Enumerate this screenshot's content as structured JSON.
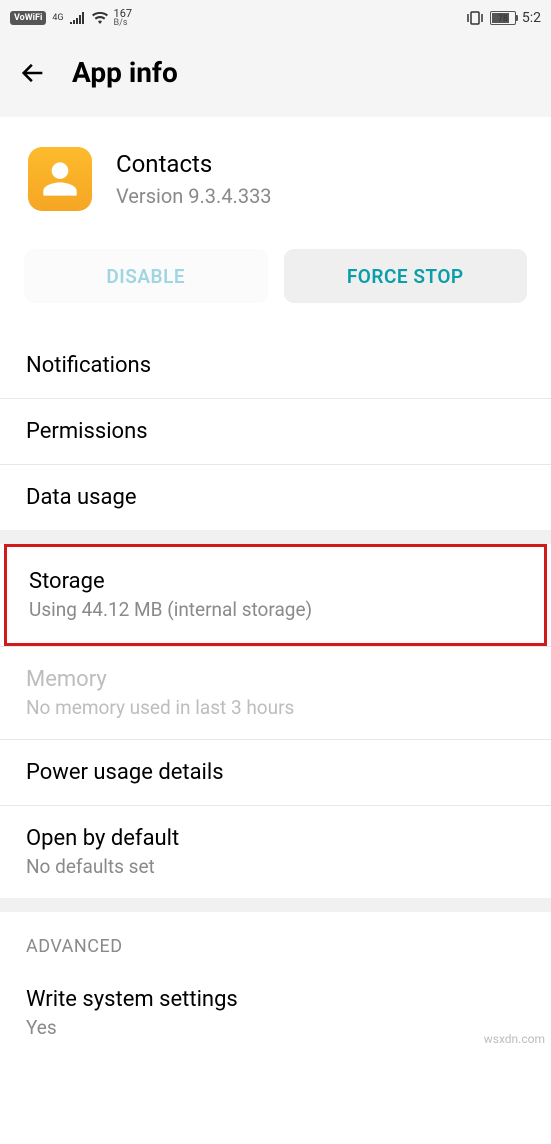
{
  "status": {
    "vowifi": "VoWiFi",
    "signal_gen": "4G",
    "net_speed_value": "167",
    "net_speed_unit": "B/s",
    "battery_pct": "78",
    "time": "5:2"
  },
  "header": {
    "title": "App info"
  },
  "app": {
    "name": "Contacts",
    "version_label": "Version 9.3.4.333"
  },
  "buttons": {
    "disable": "DISABLE",
    "force_stop": "FORCE STOP"
  },
  "items": {
    "notifications": "Notifications",
    "permissions": "Permissions",
    "data_usage": "Data usage",
    "storage": {
      "title": "Storage",
      "subtitle": "Using 44.12 MB (internal storage)"
    },
    "memory": {
      "title": "Memory",
      "subtitle": "No memory used in last 3 hours"
    },
    "power": "Power usage details",
    "open_default": {
      "title": "Open by default",
      "subtitle": "No defaults set"
    },
    "advanced_header": "ADVANCED",
    "write_sys": {
      "title": "Write system settings",
      "subtitle": "Yes"
    }
  },
  "watermark": "wsxdn.com"
}
